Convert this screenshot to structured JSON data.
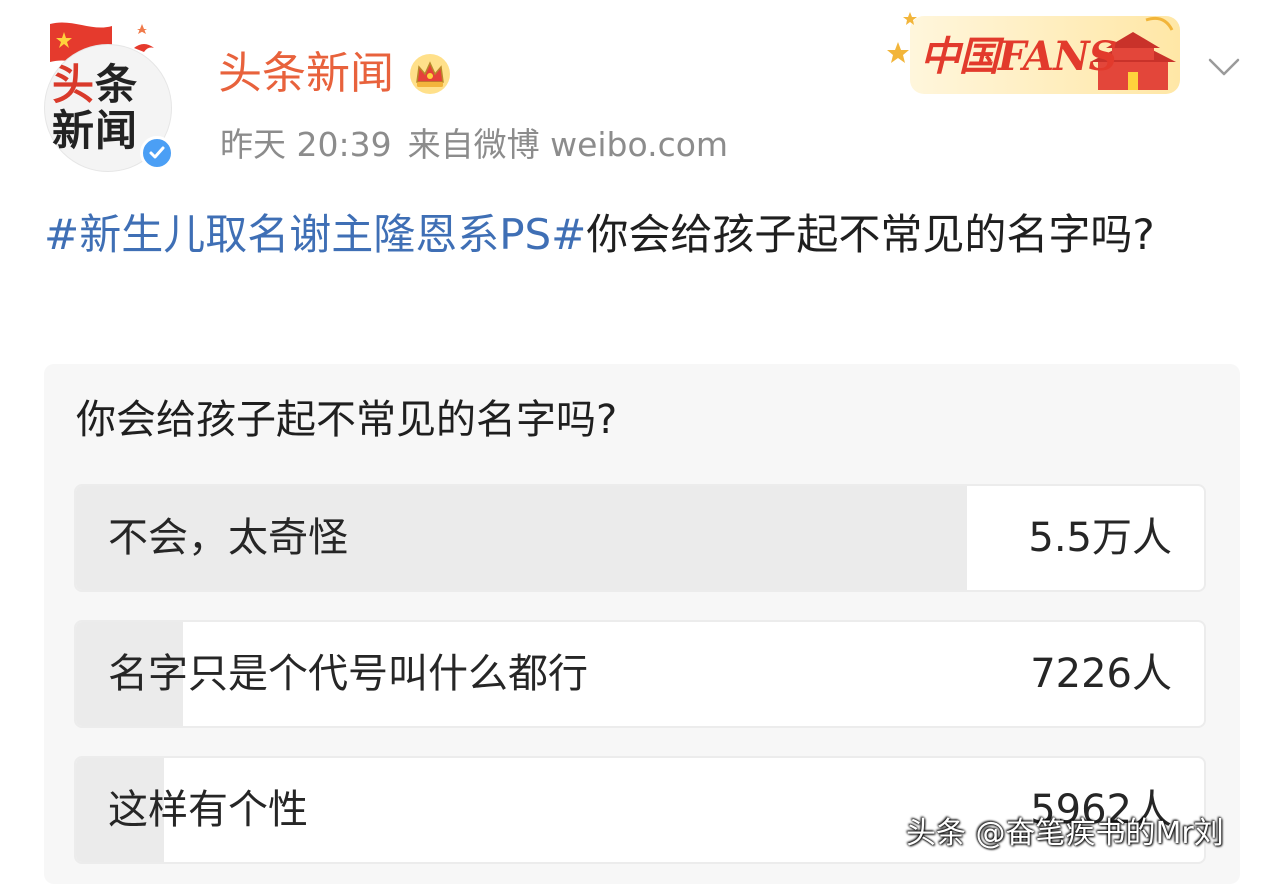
{
  "header": {
    "avatar_text_line1_a": "头",
    "avatar_text_line1_b": "条",
    "avatar_text_line2": "新闻",
    "username": "头条新闻",
    "time": "昨天 20:39",
    "source": "来自微博 weibo.com",
    "badge_text": "中国FANS"
  },
  "post": {
    "hashtag": "#新生儿取名谢主隆恩系PS#",
    "text": "你会给孩子起不常见的名字吗?"
  },
  "poll": {
    "question": "你会给孩子起不常见的名字吗?",
    "options": [
      {
        "label": "不会，太奇怪",
        "count": "5.5万人",
        "fill_fraction": 0.79
      },
      {
        "label": "名字只是个代号叫什么都行",
        "count": "7226人",
        "fill_fraction": 0.095
      },
      {
        "label": "这样有个性",
        "count": "5962人",
        "fill_fraction": 0.078
      }
    ]
  },
  "watermark": "头条 @奋笔疾书的Mr刘",
  "colors": {
    "username": "#e8623c",
    "hashtag": "#3f6fb5",
    "meta": "#8c8c8c",
    "poll_fill": "#ebebeb",
    "verified": "#4b9ff5"
  },
  "icons": [
    "chinese-flag-icon",
    "verified-icon",
    "crown-icon",
    "chevron-down-icon"
  ]
}
